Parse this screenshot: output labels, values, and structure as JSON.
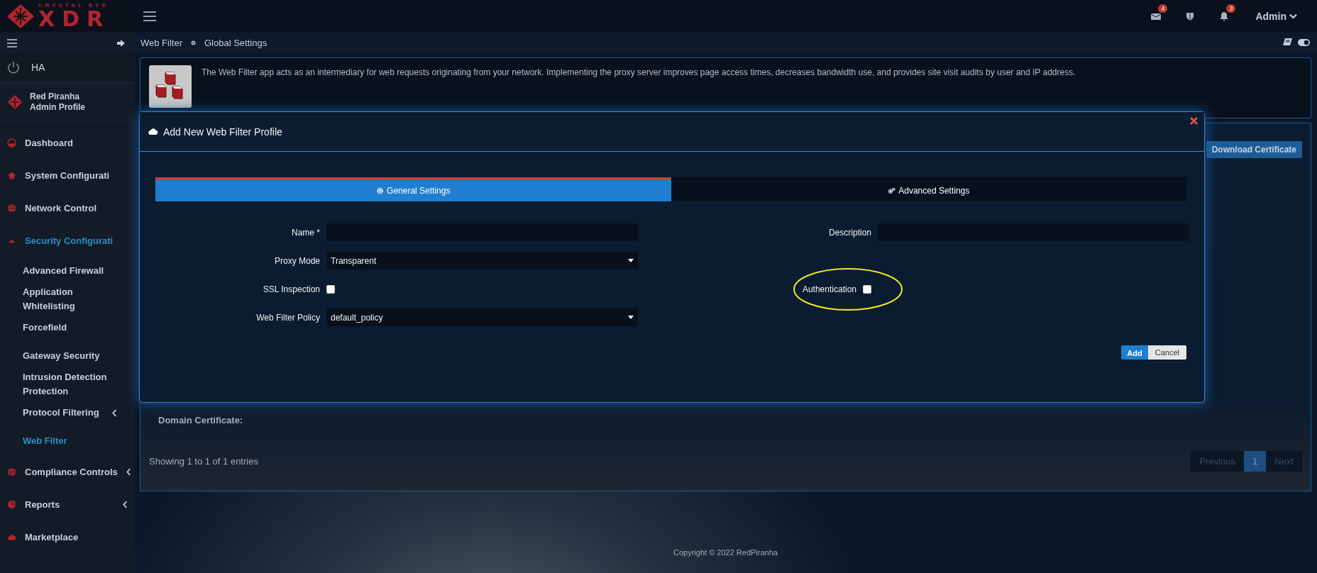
{
  "logo": {
    "tagline": "CRYSTAL EYE",
    "name": "XDR"
  },
  "topbar": {
    "messages_badge": "4",
    "alerts_badge": "3",
    "user": "Admin"
  },
  "sidebar": {
    "ha": "HA",
    "profile": {
      "name": "Red Piranha",
      "role": "Admin Profile"
    },
    "items": [
      {
        "label": "Dashboard",
        "selected": false,
        "submenu": false
      },
      {
        "label": "System Configurati",
        "selected": false,
        "submenu": false
      },
      {
        "label": "Network Control",
        "selected": false,
        "submenu": false
      },
      {
        "label": "Security Configurati",
        "selected": true,
        "expanded": true,
        "submenu": false,
        "children": [
          {
            "label": "Advanced Firewall",
            "selected": false,
            "submenu": false
          },
          {
            "label": "Application Whitelisting",
            "selected": false,
            "submenu": false
          },
          {
            "label": "Forcefield",
            "selected": false,
            "submenu": false
          },
          {
            "label": "Gateway Security",
            "selected": false,
            "submenu": false
          },
          {
            "label": "Intrusion Detection Protection",
            "selected": false,
            "submenu": false
          },
          {
            "label": "Protocol Filtering",
            "selected": false,
            "submenu": true
          },
          {
            "label": "Web Filter",
            "selected": true,
            "submenu": false
          }
        ]
      },
      {
        "label": "Compliance Controls",
        "selected": false,
        "submenu": true
      },
      {
        "label": "Reports",
        "selected": false,
        "submenu": true
      },
      {
        "label": "Marketplace",
        "selected": false,
        "submenu": false
      }
    ]
  },
  "breadcrumb": [
    "Web Filter",
    "Global Settings"
  ],
  "info": {
    "text": "The Web Filter app acts as an intermediary for web requests originating from your network. Implementing the proxy server improves page access times, decreases bandwidth use, and provides site visit audits by user and IP address."
  },
  "panel": {
    "download_button": "Download Certificate",
    "domain_certificate": "Domain Certificate:",
    "entries": "Showing 1 to 1 of 1 entries",
    "pagination": [
      {
        "label": "Previous",
        "selected": false
      },
      {
        "label": "1",
        "selected": true
      },
      {
        "label": "Next",
        "selected": false
      }
    ]
  },
  "modal": {
    "title": "Add New Web Filter Profile",
    "tabs": [
      {
        "label": "General Settings",
        "selected": true
      },
      {
        "label": "Advanced Settings",
        "selected": false
      }
    ],
    "rows": [
      {
        "left": {
          "label": "Name *",
          "kind": "text"
        },
        "right": {
          "label": "Description",
          "kind": "text"
        }
      },
      {
        "left": {
          "label": "Proxy Mode",
          "kind": "select",
          "value": "Transparent"
        }
      },
      {
        "left": {
          "label": "SSL Inspection",
          "kind": "checkbox",
          "checked": false
        },
        "right": {
          "label": "Authentication",
          "kind": "checkbox",
          "checked": false,
          "highlighted": true
        }
      },
      {
        "left": {
          "label": "Web Filter Policy",
          "kind": "select",
          "value": "default_policy"
        }
      }
    ],
    "buttons": [
      {
        "label": "Add",
        "kind": "primary"
      },
      {
        "label": "Cancel",
        "kind": "default"
      }
    ]
  },
  "footer": {
    "copyright": "Copyright © 2022 RedPiranha"
  }
}
